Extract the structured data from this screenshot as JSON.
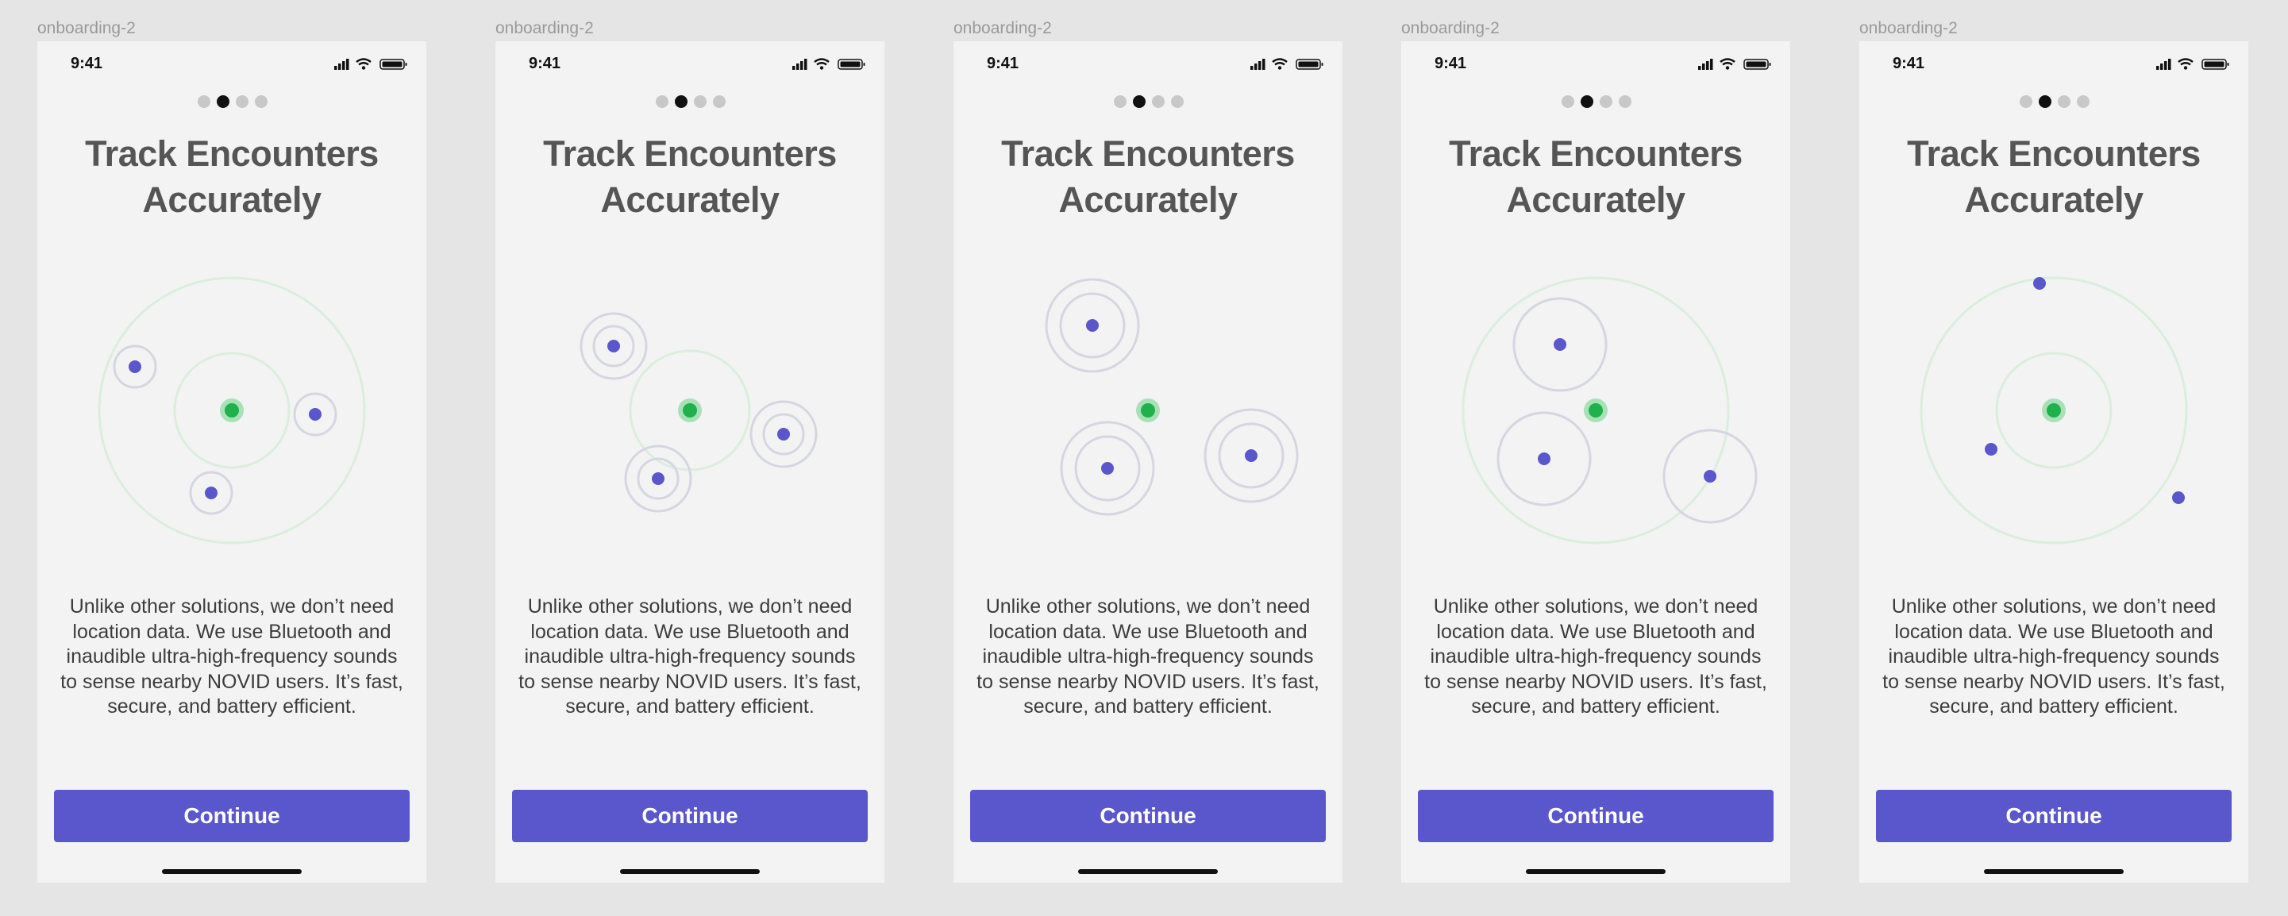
{
  "colors": {
    "canvas_bg": "#e5e5e5",
    "screen_bg": "#f3f3f3",
    "title": "#555555",
    "body_text": "#3c3c3c",
    "accent": "#5a56cc",
    "peer_dot": "#5a56cc",
    "self_dot": "#1fb14a",
    "self_halo": "#a9e0b8",
    "range_ring": "#dbeedd",
    "peer_ring": "#d6d6e2",
    "page_dot_active": "#111111",
    "page_dot_inactive": "#c8c8c8"
  },
  "frames": [
    {
      "label": "onboarding-2",
      "status_time": "9:41",
      "status_icons": [
        "signal-icon",
        "wifi-icon",
        "battery-icon"
      ],
      "page_indicator": {
        "count": 4,
        "active_index": 1
      },
      "title_lines": [
        "Track Encounters",
        "Accurately"
      ],
      "body": "Unlike other solutions, we don’t need location data. We use Bluetooth and inaudible ultra-high-frequency sounds to sense nearby NOVID users. It’s fast, secure, and battery efficient.",
      "continue_label": "Continue"
    },
    {
      "label": "onboarding-2",
      "status_time": "9:41",
      "status_icons": [
        "signal-icon",
        "wifi-icon",
        "battery-icon"
      ],
      "page_indicator": {
        "count": 4,
        "active_index": 1
      },
      "title_lines": [
        "Track Encounters",
        "Accurately"
      ],
      "body": "Unlike other solutions, we don’t need location data. We use Bluetooth and inaudible ultra-high-frequency sounds to sense nearby NOVID users. It’s fast, secure, and battery efficient.",
      "continue_label": "Continue"
    },
    {
      "label": "onboarding-2",
      "status_time": "9:41",
      "status_icons": [
        "signal-icon",
        "wifi-icon",
        "battery-icon"
      ],
      "page_indicator": {
        "count": 4,
        "active_index": 1
      },
      "title_lines": [
        "Track Encounters",
        "Accurately"
      ],
      "body": "Unlike other solutions, we don’t need location data. We use Bluetooth and inaudible ultra-high-frequency sounds to sense nearby NOVID users. It’s fast, secure, and battery efficient.",
      "continue_label": "Continue"
    },
    {
      "label": "onboarding-2",
      "status_time": "9:41",
      "status_icons": [
        "signal-icon",
        "wifi-icon",
        "battery-icon"
      ],
      "page_indicator": {
        "count": 4,
        "active_index": 1
      },
      "title_lines": [
        "Track Encounters",
        "Accurately"
      ],
      "body": "Unlike other solutions, we don’t need location data. We use Bluetooth and inaudible ultra-high-frequency sounds to sense nearby NOVID users. It’s fast, secure, and battery efficient.",
      "continue_label": "Continue"
    },
    {
      "label": "onboarding-2",
      "status_time": "9:41",
      "status_icons": [
        "signal-icon",
        "wifi-icon",
        "battery-icon"
      ],
      "page_indicator": {
        "count": 4,
        "active_index": 1
      },
      "title_lines": [
        "Track Encounters",
        "Accurately"
      ],
      "body": "Unlike other solutions, we don’t need location data. We use Bluetooth and inaudible ultra-high-frequency sounds to sense nearby NOVID users. It’s fast, secure, and battery efficient.",
      "continue_label": "Continue"
    }
  ]
}
